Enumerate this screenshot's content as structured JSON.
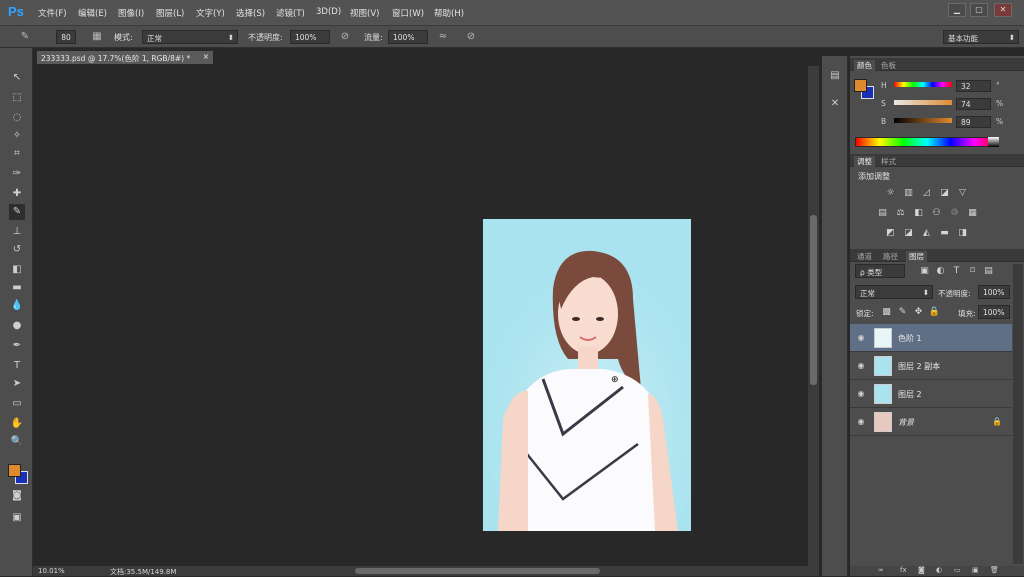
{
  "menubar": {
    "logo": "Ps",
    "items": [
      "文件(F)",
      "编辑(E)",
      "图像(I)",
      "图层(L)",
      "文字(Y)",
      "选择(S)",
      "滤镜(T)",
      "3D(D)",
      "视图(V)",
      "窗口(W)",
      "帮助(H)"
    ],
    "window_buttons": [
      "▁",
      "▢",
      "✕"
    ]
  },
  "options": {
    "brush_size": "80",
    "mode_label": "模式:",
    "mode_value": "正常",
    "opacity_label": "不透明度:",
    "opacity_value": "100%",
    "flow_label": "流量:",
    "flow_value": "100%",
    "workspace": "基本功能"
  },
  "document": {
    "tab_title": "233333.psd @ 17.7%(色阶 1, RGB/8#) *",
    "tab_close": "×",
    "zoom": "10.01%",
    "doc_info": "文档:35.5M/149.8M"
  },
  "color_panel": {
    "tabs": [
      "颜色",
      "色板"
    ],
    "h_label": "H",
    "h_value": "32",
    "h_unit": "°",
    "s_label": "S",
    "s_value": "74",
    "s_unit": "%",
    "b_label": "B",
    "b_value": "89",
    "b_unit": "%"
  },
  "adjust_panel": {
    "tabs": [
      "调整",
      "样式"
    ],
    "title": "添加调整"
  },
  "layers_panel": {
    "tabs": [
      "通道",
      "路径",
      "图层"
    ],
    "filter_kind": "ρ 类型",
    "blend_mode": "正常",
    "opacity_label": "不透明度:",
    "opacity_value": "100%",
    "lock_label": "锁定:",
    "fill_label": "填充:",
    "fill_value": "100%",
    "layers": [
      {
        "name": "色阶 1"
      },
      {
        "name": "图层 2 副本"
      },
      {
        "name": "图层 2"
      },
      {
        "name": "背景"
      }
    ]
  },
  "colors": {
    "foreground": "#e08a30",
    "background": "#1a2fb8",
    "accent": "#2fa3ff",
    "image_bg": "#a9e3ef"
  }
}
